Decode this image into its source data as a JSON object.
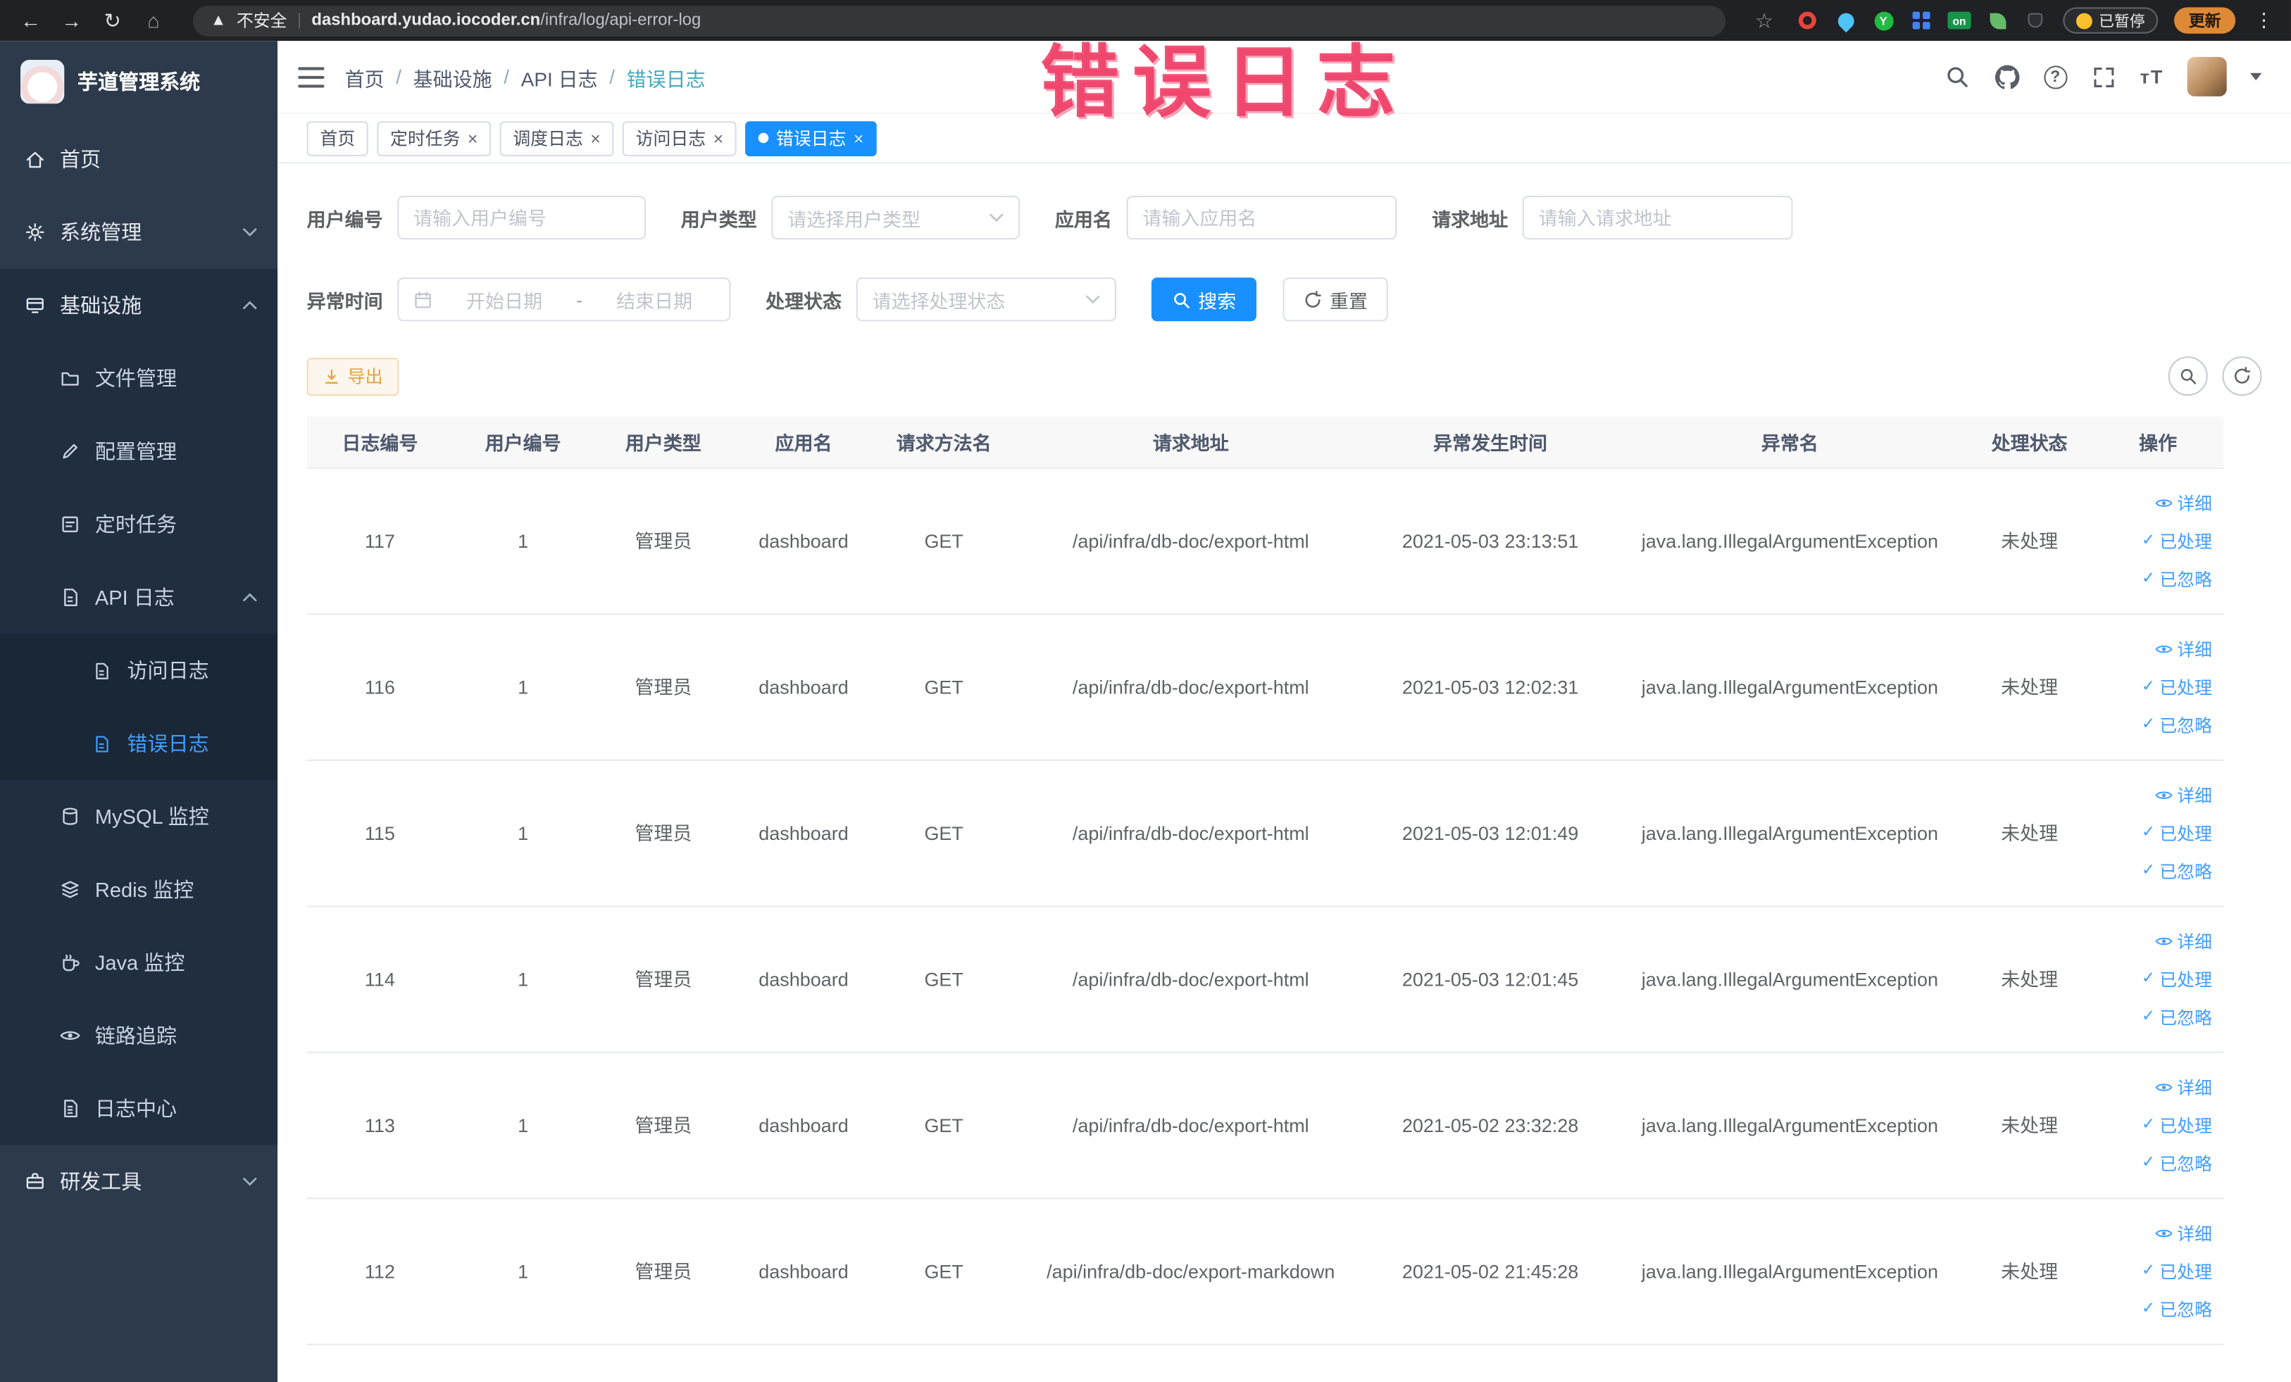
{
  "browser": {
    "security_label": "不安全",
    "url_domain": "dashboard.yudao.iocoder.cn",
    "url_path": "/infra/log/api-error-log",
    "extension_on_badge": "on",
    "paused_label": "已暂停",
    "update_label": "更新"
  },
  "annotation": {
    "text": "错误日志"
  },
  "sidebar": {
    "logo_title": "芋道管理系统",
    "items": [
      {
        "label": "首页"
      },
      {
        "label": "系统管理"
      },
      {
        "label": "基础设施"
      },
      {
        "label": "文件管理"
      },
      {
        "label": "配置管理"
      },
      {
        "label": "定时任务"
      },
      {
        "label": "API 日志"
      },
      {
        "label": "访问日志"
      },
      {
        "label": "错误日志"
      },
      {
        "label": "MySQL 监控"
      },
      {
        "label": "Redis 监控"
      },
      {
        "label": "Java 监控"
      },
      {
        "label": "链路追踪"
      },
      {
        "label": "日志中心"
      },
      {
        "label": "研发工具"
      }
    ]
  },
  "breadcrumb": [
    "首页",
    "基础设施",
    "API 日志",
    "错误日志"
  ],
  "tabs": [
    {
      "label": "首页"
    },
    {
      "label": "定时任务"
    },
    {
      "label": "调度日志"
    },
    {
      "label": "访问日志"
    },
    {
      "label": "错误日志"
    }
  ],
  "filters": {
    "user_id_label": "用户编号",
    "user_id_placeholder": "请输入用户编号",
    "user_type_label": "用户类型",
    "user_type_placeholder": "请选择用户类型",
    "app_name_label": "应用名",
    "app_name_placeholder": "请输入应用名",
    "request_url_label": "请求地址",
    "request_url_placeholder": "请输入请求地址",
    "exception_time_label": "异常时间",
    "date_start_placeholder": "开始日期",
    "date_separator": "-",
    "date_end_placeholder": "结束日期",
    "process_status_label": "处理状态",
    "process_status_placeholder": "请选择处理状态",
    "search_label": "搜索",
    "reset_label": "重置"
  },
  "toolbar": {
    "export_label": "导出"
  },
  "table": {
    "columns": [
      "日志编号",
      "用户编号",
      "用户类型",
      "应用名",
      "请求方法名",
      "请求地址",
      "异常发生时间",
      "异常名",
      "处理状态",
      "操作"
    ],
    "actions": {
      "detail": "详细",
      "processed": "已处理",
      "ignored": "已忽略"
    },
    "rows": [
      {
        "id": "117",
        "user_id": "1",
        "user_type": "管理员",
        "app": "dashboard",
        "method": "GET",
        "url": "/api/infra/db-doc/export-html",
        "time": "2021-05-03 23:13:51",
        "exception": "java.lang.IllegalArgumentException",
        "status": "未处理"
      },
      {
        "id": "116",
        "user_id": "1",
        "user_type": "管理员",
        "app": "dashboard",
        "method": "GET",
        "url": "/api/infra/db-doc/export-html",
        "time": "2021-05-03 12:02:31",
        "exception": "java.lang.IllegalArgumentException",
        "status": "未处理"
      },
      {
        "id": "115",
        "user_id": "1",
        "user_type": "管理员",
        "app": "dashboard",
        "method": "GET",
        "url": "/api/infra/db-doc/export-html",
        "time": "2021-05-03 12:01:49",
        "exception": "java.lang.IllegalArgumentException",
        "status": "未处理"
      },
      {
        "id": "114",
        "user_id": "1",
        "user_type": "管理员",
        "app": "dashboard",
        "method": "GET",
        "url": "/api/infra/db-doc/export-html",
        "time": "2021-05-03 12:01:45",
        "exception": "java.lang.IllegalArgumentException",
        "status": "未处理"
      },
      {
        "id": "113",
        "user_id": "1",
        "user_type": "管理员",
        "app": "dashboard",
        "method": "GET",
        "url": "/api/infra/db-doc/export-html",
        "time": "2021-05-02 23:32:28",
        "exception": "java.lang.IllegalArgumentException",
        "status": "未处理"
      },
      {
        "id": "112",
        "user_id": "1",
        "user_type": "管理员",
        "app": "dashboard",
        "method": "GET",
        "url": "/api/infra/db-doc/export-markdown",
        "time": "2021-05-02 21:45:28",
        "exception": "java.lang.IllegalArgumentException",
        "status": "未处理"
      }
    ]
  }
}
